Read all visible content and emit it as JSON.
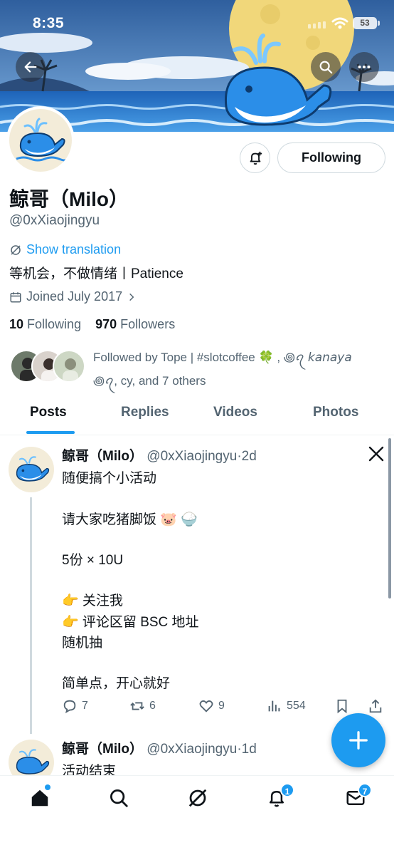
{
  "status_bar": {
    "time": "8:35",
    "battery": "53"
  },
  "profile": {
    "name": "鲸哥（Milo）",
    "handle": "@0xXiaojingyu",
    "show_translation": "Show translation",
    "bio": "等机会，不做情绪丨Patience",
    "joined": "Joined July 2017",
    "following_count": "10",
    "following_label": "Following",
    "followers_count": "970",
    "followers_label": "Followers",
    "followed_by_line1": "Followed by Tope | #slotcoffee 🍀 , ꩜ꪖ 𝘬𝘢𝘯𝘢𝘺𝘢",
    "followed_by_line2": "꩜ꪖ, cy, and 7 others",
    "following_button": "Following"
  },
  "tabs": [
    {
      "label": "Posts",
      "active": true
    },
    {
      "label": "Replies",
      "active": false
    },
    {
      "label": "Videos",
      "active": false
    },
    {
      "label": "Photos",
      "active": false
    }
  ],
  "posts": [
    {
      "name": "鲸哥（Milo）",
      "handle": "@0xXiaojingyu",
      "sep": "·",
      "time": "2d",
      "lines": [
        "随便搞个小活动",
        "请大家吃猪脚饭 🐷 🍚",
        "5份 × 10U",
        "👉 关注我",
        "👉 评论区留 BSC 地址",
        "随机抽",
        "简单点，开心就好"
      ],
      "replies": "7",
      "reposts": "6",
      "likes": "9",
      "views": "554"
    },
    {
      "name": "鲸哥（Milo）",
      "handle": "@0xXiaojingyu",
      "sep": "·",
      "time": "1d",
      "lines": [
        "活动结束"
      ]
    }
  ],
  "nav": {
    "notifications_badge": "1",
    "messages_badge": "7"
  },
  "colors": {
    "accent": "#1d9bf0",
    "text": "#0f1419",
    "secondary": "#536471"
  }
}
